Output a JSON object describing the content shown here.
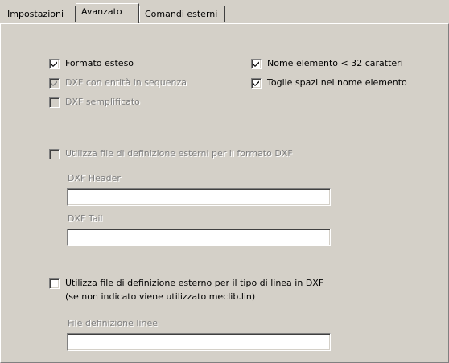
{
  "tabs": [
    {
      "label": "Impostazioni",
      "selected": false
    },
    {
      "label": "Avanzato",
      "selected": true
    },
    {
      "label": "Comandi esterni",
      "selected": false
    }
  ],
  "options": {
    "formato_esteso": {
      "label": "Formato esteso",
      "checked": true,
      "enabled": true
    },
    "dxf_sequenza": {
      "label": "DXF con entità in sequenza",
      "checked": true,
      "enabled": false
    },
    "dxf_semplificato": {
      "label": "DXF semplificato",
      "checked": false,
      "enabled": false
    },
    "nome_elemento": {
      "label": "Nome elemento < 32 caratteri",
      "checked": true,
      "enabled": true
    },
    "toglie_spazi": {
      "label": "Toglie spazi nel nome elemento",
      "checked": true,
      "enabled": true
    }
  },
  "external_defs": {
    "checkbox_label": "Utilizza file di definizione esterni per il formato DXF",
    "checked": false,
    "enabled": false,
    "header_label": "DXF Header",
    "header_value": "",
    "tail_label": "DXF Tail",
    "tail_value": ""
  },
  "linetype": {
    "checkbox_label_line1": "Utilizza file di definizione esterno per il tipo di linea in DXF",
    "checkbox_label_line2": "(se non indicato viene utilizzato meclib.lin)",
    "checked": false,
    "enabled": true,
    "file_label": "File definizione linee",
    "file_value": ""
  },
  "colors": {
    "face": "#d4d0c8",
    "disabled_text": "#808080"
  }
}
